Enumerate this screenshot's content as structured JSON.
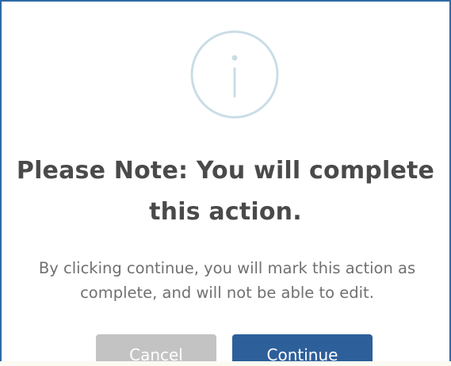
{
  "dialog": {
    "icon": "info-circle-icon",
    "title": "Please Note: You will complete this action.",
    "message": "By clicking continue, you will mark this action as complete, and will not be able to edit.",
    "buttons": {
      "cancel_label": "Cancel",
      "continue_label": "Continue"
    }
  },
  "colors": {
    "border": "#2d6aa6",
    "icon": "#c9dde6",
    "title": "#4a4a4a",
    "message": "#707070",
    "cancel_bg": "#c3c3c3",
    "continue_bg": "#2d5f9a"
  }
}
